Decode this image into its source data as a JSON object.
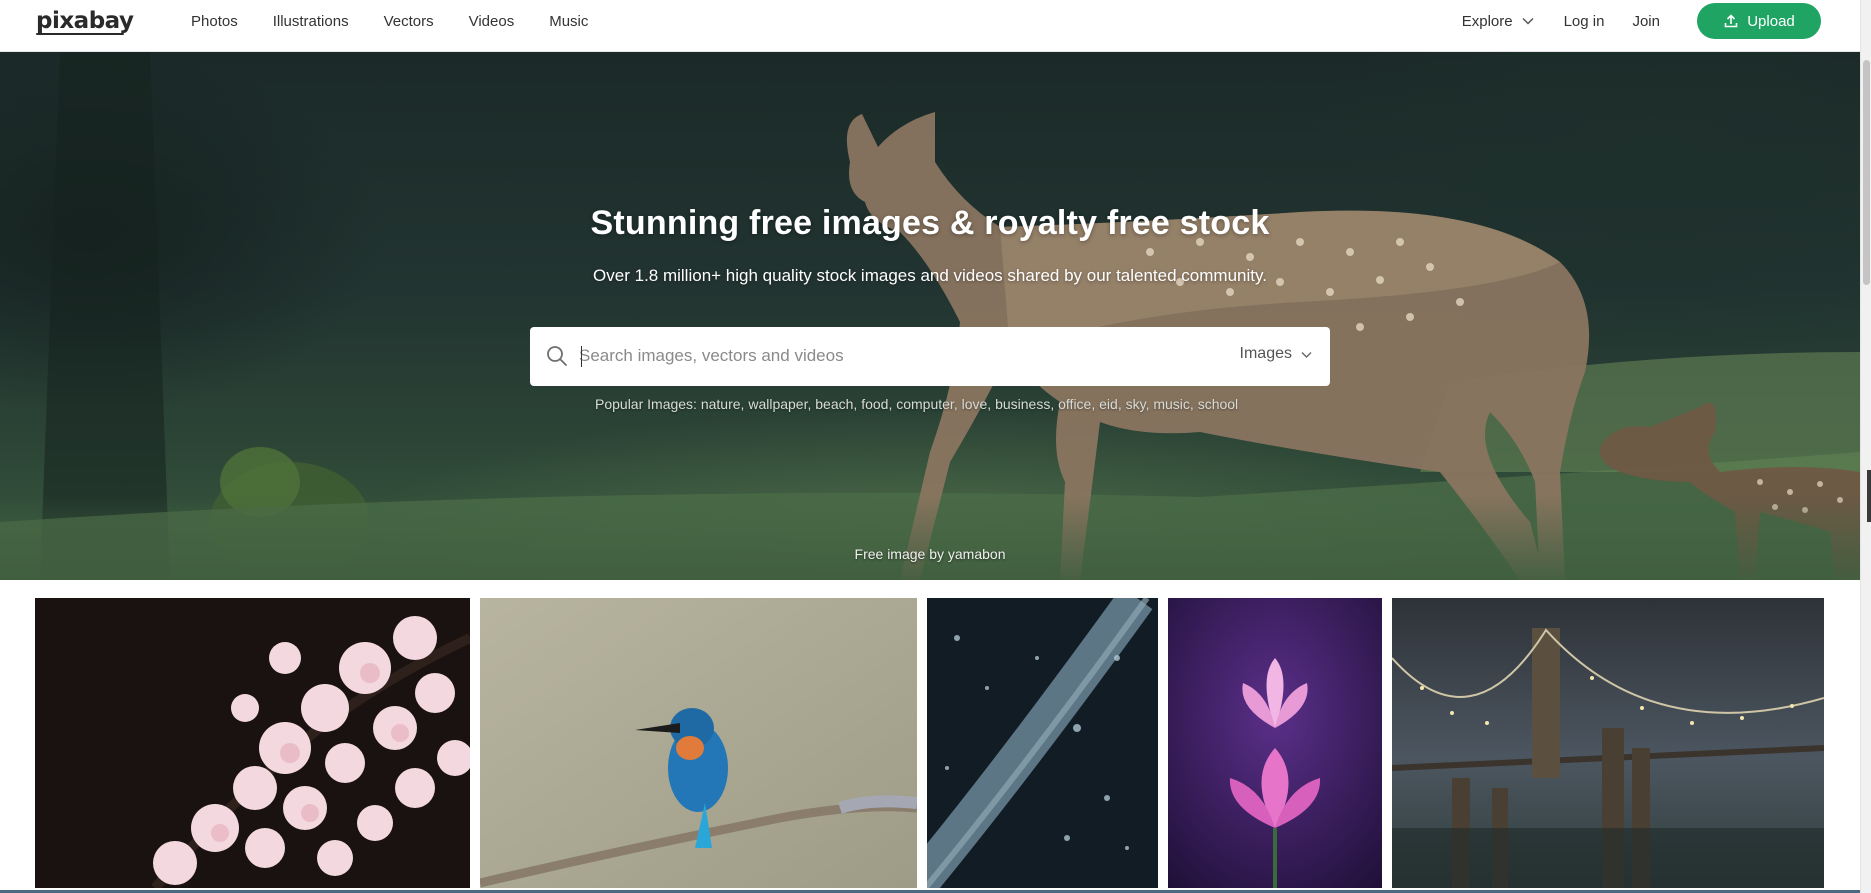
{
  "brand": {
    "logo_text": "pixabay"
  },
  "nav": {
    "items": [
      {
        "label": "Photos"
      },
      {
        "label": "Illustrations"
      },
      {
        "label": "Vectors"
      },
      {
        "label": "Videos"
      },
      {
        "label": "Music"
      }
    ]
  },
  "header_right": {
    "explore_label": "Explore",
    "login_label": "Log in",
    "join_label": "Join",
    "upload_label": "Upload",
    "upload_color": "#1fa463"
  },
  "hero": {
    "title": "Stunning free images & royalty free stock",
    "subtitle": "Over 1.8 million+ high quality stock images and videos shared by our talented community.",
    "search": {
      "placeholder": "Search images, vectors and videos",
      "value": "",
      "type_selected": "Images"
    },
    "popular_prefix": "Popular Images:",
    "popular_tags": [
      "nature",
      "wallpaper",
      "beach",
      "food",
      "computer",
      "love",
      "business",
      "office",
      "eid",
      "sky",
      "music",
      "school"
    ],
    "credit": "Free image by yamabon"
  },
  "gallery": {
    "tiles": [
      {
        "subject": "cherry-blossom"
      },
      {
        "subject": "kingfisher"
      },
      {
        "subject": "rain-railing"
      },
      {
        "subject": "lotus"
      },
      {
        "subject": "brooklyn-bridge"
      }
    ]
  },
  "icons": {
    "search": "search-icon",
    "upload": "upload-icon",
    "chevron": "chevron-down-icon"
  }
}
